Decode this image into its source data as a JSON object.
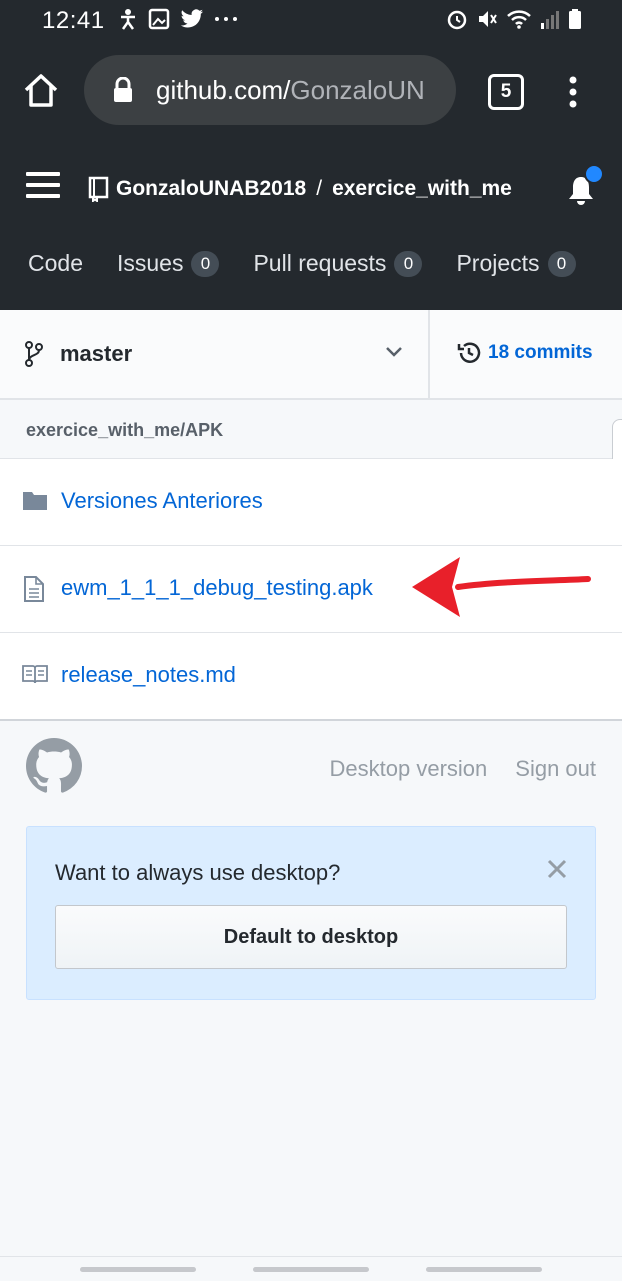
{
  "status_bar": {
    "time": "12:41",
    "left_icons": [
      "accessibility-icon",
      "gallery-icon",
      "twitter-icon",
      "more-dots-icon"
    ],
    "right_icons": [
      "alarm-icon",
      "mute-icon",
      "wifi-icon",
      "signal-icon",
      "battery-icon"
    ]
  },
  "browser": {
    "url_host": "github.com/",
    "url_path": "GonzaloUN",
    "tab_count": "5"
  },
  "repo": {
    "owner": "GonzaloUNAB2018",
    "separator": "/",
    "name": "exercice_with_me"
  },
  "nav_tabs": [
    {
      "label": "Code",
      "count": ""
    },
    {
      "label": "Issues",
      "count": "0"
    },
    {
      "label": "Pull requests",
      "count": "0"
    },
    {
      "label": "Projects",
      "count": "0"
    }
  ],
  "branch": {
    "name": "master",
    "commits_label": "18 commits"
  },
  "path": "exercice_with_me/APK",
  "files": [
    {
      "name": "Versiones Anteriores",
      "icon": "folder-icon"
    },
    {
      "name": "ewm_1_1_1_debug_testing.apk",
      "icon": "file-icon"
    },
    {
      "name": "release_notes.md",
      "icon": "book-icon"
    }
  ],
  "annotation": {
    "arrow_color": "#e8202a"
  },
  "footer": {
    "desktop_version": "Desktop version",
    "sign_out": "Sign out"
  },
  "banner": {
    "question": "Want to always use desktop?",
    "button_label": "Default to desktop"
  },
  "colors": {
    "header_bg": "#24292e",
    "link": "#0366d6",
    "notification_dot": "#2188ff"
  }
}
